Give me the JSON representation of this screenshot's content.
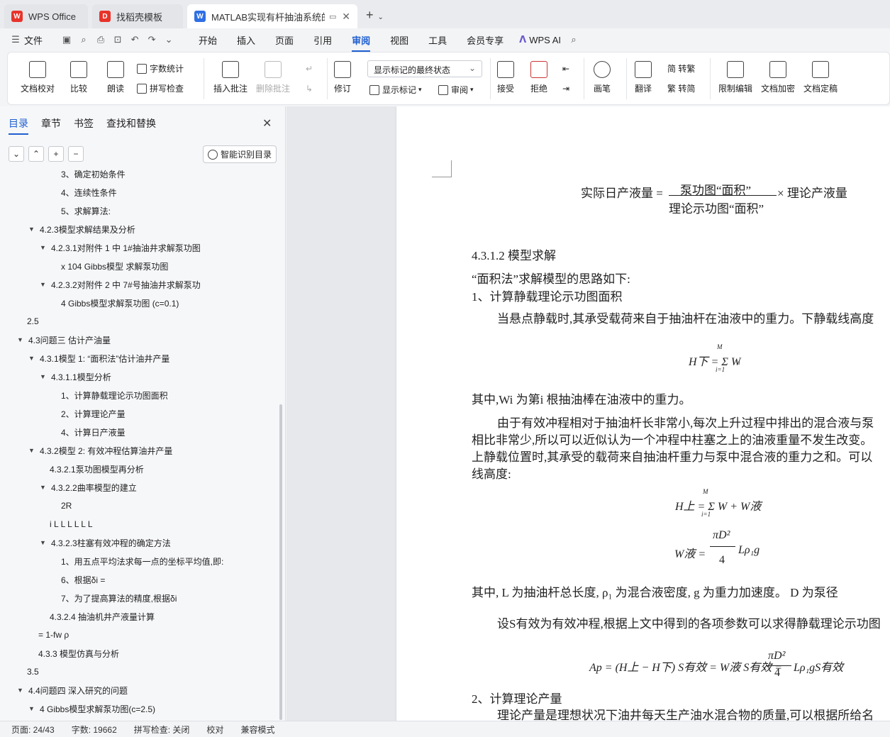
{
  "tabs": {
    "home": "WPS Office",
    "templates": "找稻壳模板",
    "doc": "MATLAB实现有杆抽油系统的..."
  },
  "menu": {
    "file": "文件",
    "items": [
      "开始",
      "插入",
      "页面",
      "引用",
      "审阅",
      "视图",
      "工具",
      "会员专享"
    ],
    "active": "审阅",
    "ai": "WPS AI"
  },
  "ribbon": {
    "proofread": "文档校对",
    "compare": "比较",
    "read_aloud": "朗读",
    "word_count": "字数统计",
    "spell_check": "拼写检查",
    "insert_comment": "插入批注",
    "delete_comment": "删除批注",
    "revise": "修订",
    "markup_state": "显示标记的最终状态",
    "show_markup": "显示标记",
    "review": "审阅",
    "accept": "接受",
    "reject": "拒绝",
    "pen": "画笔",
    "translate": "翻译",
    "to_traditional": "简 转繁",
    "to_simplified": "繁 转简",
    "restrict_edit": "限制编辑",
    "encrypt": "文档加密",
    "finalize": "文档定稿"
  },
  "nav": {
    "tabs": [
      "目录",
      "章节",
      "书签",
      "查找和替换"
    ],
    "active_tab": "目录",
    "smart_button": "智能识别目录",
    "toc": [
      {
        "label": "3、确定初始条件",
        "level": 3,
        "caret": false
      },
      {
        "label": "4、连续性条件",
        "level": 3,
        "caret": false
      },
      {
        "label": "5、求解算法:",
        "level": 3,
        "caret": false
      },
      {
        "label": "4.2.3模型求解结果及分析",
        "level": 1,
        "caret": true
      },
      {
        "label": "4.2.3.1对附件 1 中 1#抽油井求解泵功图",
        "level": 2,
        "caret": true
      },
      {
        "label": "x 104 Gibbs模型 求解泵功图",
        "level": 3,
        "caret": false
      },
      {
        "label": "4.2.3.2对附件 2 中 7#号抽油井求解泵功",
        "level": 2,
        "caret": true
      },
      {
        "label": "4 Gibbs模型求解泵功图 (c=0.1)",
        "level": 3,
        "caret": false
      },
      {
        "label": "2.5",
        "level": -1,
        "caret": false
      },
      {
        "label": "4.3问题三 估计产油量",
        "level": 0,
        "caret": true
      },
      {
        "label": "4.3.1模型 1: “面积法”估计油井产量",
        "level": 1,
        "caret": true
      },
      {
        "label": "4.3.1.1模型分析",
        "level": 2,
        "caret": true
      },
      {
        "label": "1、计算静载理论示功图面积",
        "level": 3,
        "caret": false
      },
      {
        "label": "2、计算理论产量",
        "level": 3,
        "caret": false
      },
      {
        "label": "4、计算日产液量",
        "level": 3,
        "caret": false
      },
      {
        "label": "4.3.2模型 2: 有效冲程估算油井产量",
        "level": 1,
        "caret": true
      },
      {
        "label": "4.3.2.1泵功图模型再分析",
        "level": 2,
        "caret": false
      },
      {
        "label": "4.3.2.2曲率模型的建立",
        "level": 2,
        "caret": true
      },
      {
        "label": "2R",
        "level": 3,
        "caret": false
      },
      {
        "label": "i L   L L L L L",
        "level": 2,
        "caret": false
      },
      {
        "label": "4.3.2.3柱塞有效冲程的确定方法",
        "level": 2,
        "caret": true
      },
      {
        "label": "1、用五点平均法求每一点的坐标平均值,即:",
        "level": 3,
        "caret": false
      },
      {
        "label": "6、根据δi =",
        "level": 3,
        "caret": false
      },
      {
        "label": "7、为了提高算法的精度,根据δi",
        "level": 3,
        "caret": false
      },
      {
        "label": "4.3.2.4 抽油机井产液量计算",
        "level": 2,
        "caret": false
      },
      {
        "label": "= 1-fw ρ",
        "level": 1,
        "caret": false
      },
      {
        "label": "4.3.3 模型仿真与分析",
        "level": 1,
        "caret": false
      },
      {
        "label": "3.5",
        "level": -1,
        "caret": false
      },
      {
        "label": "4.4问题四 深入研究的问题",
        "level": 0,
        "caret": true
      },
      {
        "label": "4 Gibbs模型求解泵功图(c=2.5)",
        "level": 1,
        "caret": true
      }
    ]
  },
  "doc": {
    "eq1_left": "实际日产液量 =",
    "eq1_num": "泵功图“面积”",
    "eq1_den": "理论示功图“面积”",
    "eq1_right": "× 理论产液量",
    "h_4312": "4.3.1.2 模型求解",
    "p1": "“面积法”求解模型的思路如下:",
    "p2": "1、计算静载理论示功图面积",
    "p3": "当悬点静载时,其承受载荷来自于抽油杆在油液中的重力。下静载线高度",
    "eq2": "H下 = Σ W",
    "eq2_sup": "M",
    "eq2_sub": "i=1",
    "eq2_wsub": "i",
    "p4": "其中,Wi 为第i 根抽油棒在油液中的重力。",
    "p5": "由于有效冲程相对于抽油杆长非常小,每次上升过程中排出的混合液与泵",
    "p6": "相比非常少,所以可以近似认为一个冲程中柱塞之上的油液重量不发生改变。",
    "p7": "上静载位置时,其承受的载荷来自抽油杆重力与泵中混合液的重力之和。可以",
    "p8": "线高度:",
    "eq3": "H上 = Σ W + W液",
    "eq3_sup": "M",
    "eq3_sub": "i=1",
    "eq4_left": "W液 =",
    "eq4_num": "πD²",
    "eq4_den": "4",
    "eq4_right": "Lρ₁g",
    "p9": "其中, L 为抽油杆总长度, ρ₁ 为混合液密度, g 为重力加速度。 D 为泵径",
    "p10": "设S有效为有效冲程,根据上文中得到的各项参数可以求得静载理论示功图",
    "eq5_left": "Ap = (H上 − H下) S有效 = W液 S有效 =",
    "eq5_num": "πD²",
    "eq5_den": "4",
    "eq5_right": "Lρ₁gS有效",
    "p11": "2、计算理论产量",
    "p12": "理论产量是理想状况下油井每天生产油水混合物的质量,可以根据所给名"
  },
  "status": {
    "page": "页面: 24/43",
    "words": "字数: 19662",
    "spell": "拼写检查: 关闭",
    "proof": "校对",
    "compat": "兼容模式"
  },
  "colors": {
    "accent": "#1f5fd1",
    "wps_red": "#e8332a"
  }
}
